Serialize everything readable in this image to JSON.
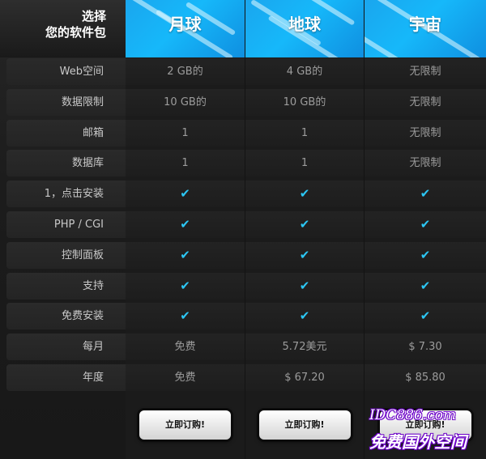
{
  "title": {
    "line1": "选择",
    "line2": "您的软件包"
  },
  "plans": [
    {
      "name": "月球",
      "button": "立即订购!"
    },
    {
      "name": "地球",
      "button": "立即订购!"
    },
    {
      "name": "宇宙",
      "button": "立即订购!"
    }
  ],
  "rows": [
    {
      "label": "Web空间",
      "values": [
        "2 GB的",
        "4 GB的",
        "无限制"
      ]
    },
    {
      "label": "数据限制",
      "values": [
        "10 GB的",
        "10 GB的",
        "无限制"
      ]
    },
    {
      "label": "邮箱",
      "values": [
        "1",
        "1",
        "无限制"
      ]
    },
    {
      "label": "数据库",
      "values": [
        "1",
        "1",
        "无限制"
      ]
    },
    {
      "label": "1，点击安装",
      "values": [
        "✔",
        "✔",
        "✔"
      ]
    },
    {
      "label": "PHP / CGI",
      "values": [
        "✔",
        "✔",
        "✔"
      ]
    },
    {
      "label": "控制面板",
      "values": [
        "✔",
        "✔",
        "✔"
      ]
    },
    {
      "label": "支持",
      "values": [
        "✔",
        "✔",
        "✔"
      ]
    },
    {
      "label": "免费安装",
      "values": [
        "✔",
        "✔",
        "✔"
      ]
    },
    {
      "label": "每月",
      "values": [
        "免费",
        "5.72美元",
        "$ 7.30"
      ]
    },
    {
      "label": "年度",
      "values": [
        "免费",
        "$ 67.20",
        "$ 85.80"
      ]
    }
  ],
  "watermark": {
    "line1": "IDC886.com",
    "line2": "免费国外空间"
  },
  "colors": {
    "header": "#16b8fa",
    "check": "#2cc7f4",
    "background": "#131313"
  }
}
